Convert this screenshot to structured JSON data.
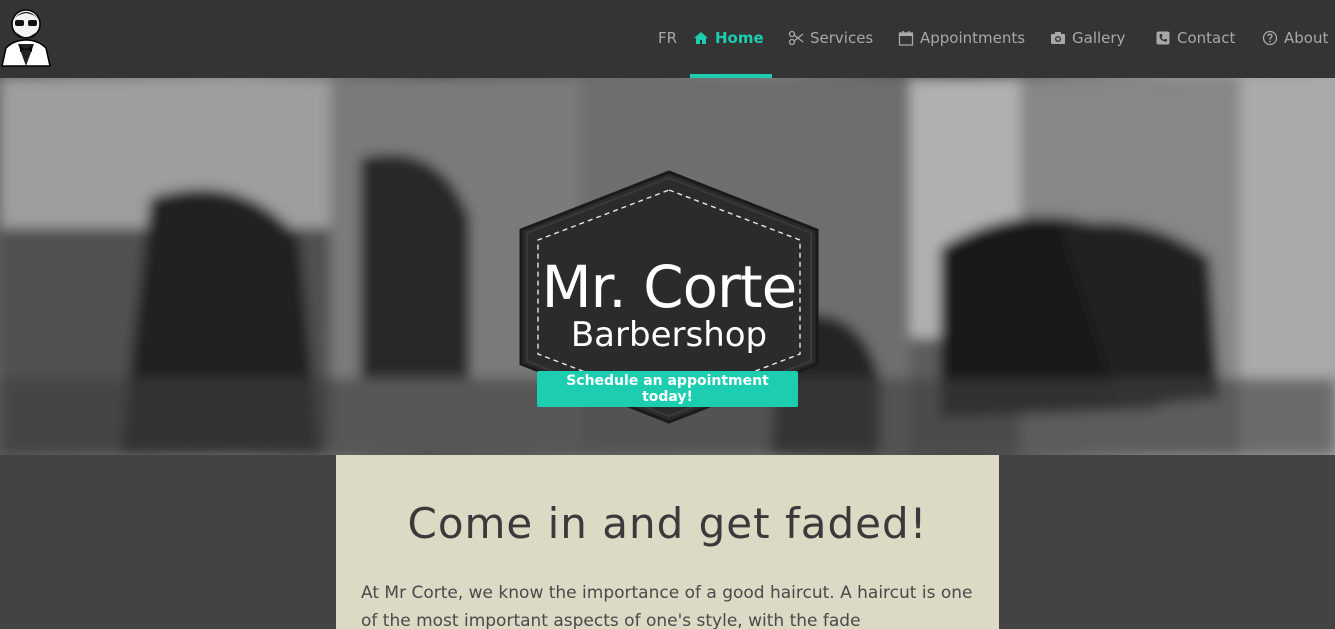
{
  "nav": {
    "lang": "FR",
    "items": [
      {
        "label": "Home",
        "icon": "home-icon",
        "active": true
      },
      {
        "label": "Services",
        "icon": "scissors-icon"
      },
      {
        "label": "Appointments",
        "icon": "calendar-icon"
      },
      {
        "label": "Gallery",
        "icon": "camera-icon"
      },
      {
        "label": "Contact",
        "icon": "phone-icon"
      },
      {
        "label": "About",
        "icon": "question-circle-icon"
      }
    ]
  },
  "hero": {
    "brand_name": "Mr. Corte",
    "brand_sub": "Barbershop",
    "cta_label": "Schedule an appointment today!"
  },
  "intro": {
    "heading": "Come in and get faded!",
    "body": "At Mr Corte, we know the importance of a good haircut. A haircut is one of the most important aspects of one's style, with the fade"
  },
  "colors": {
    "accent": "#1ccdb0",
    "navbar": "#343434",
    "content_bg": "#dcd9c5",
    "page_bg": "#434343"
  }
}
